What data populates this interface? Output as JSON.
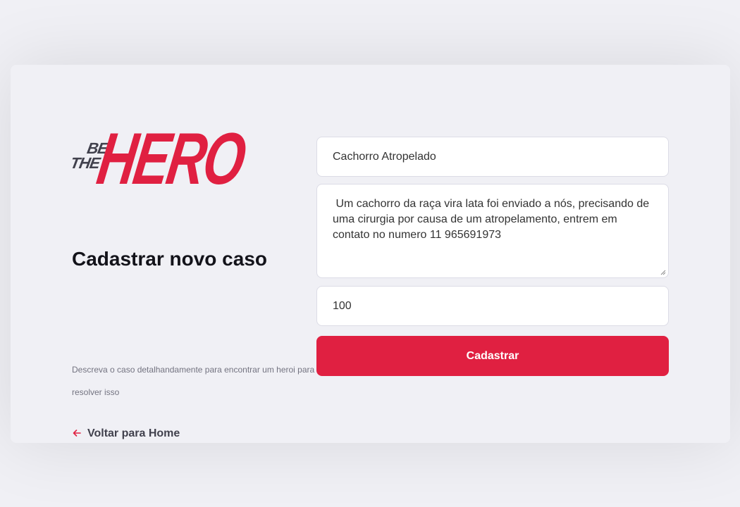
{
  "logo": {
    "be": "BE",
    "the": "THE",
    "hero": "HERO"
  },
  "page": {
    "title": "Cadastrar novo caso",
    "description": "Descreva o caso detalhandamente para encontrar um heroi para resolver isso",
    "back_link": "Voltar para Home"
  },
  "form": {
    "title_value": "Cachorro Atropelado",
    "description_value": " Um cachorro da raça vira lata foi enviado a nós, precisando de uma cirurgia por causa de um atropelamento, entrem em contato no numero 11 965691973",
    "value_value": "100",
    "submit_label": "Cadastrar"
  },
  "colors": {
    "brand": "#e02041",
    "background": "#f0f0f5",
    "dark_text": "#41414d"
  },
  "icons": {
    "back": "arrow-left-icon"
  }
}
